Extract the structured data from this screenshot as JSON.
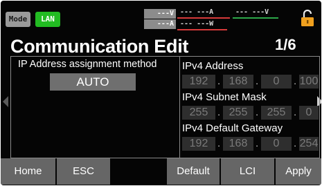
{
  "status_bar": {
    "mode_label": "Mode",
    "connection_label": "LAN",
    "meter": {
      "row1_gray": "---V",
      "row2_gray": "---A",
      "row1_current": "--- ---A",
      "row1_voltage": "--- ---V",
      "row2_power": "--- ---W"
    },
    "lock_icon": "lock-icon"
  },
  "title": "Communication Edit",
  "page_indicator": "1/6",
  "ip_assignment": {
    "label": "IP Address assignment method",
    "value": "AUTO"
  },
  "ipv4_address": {
    "label": "IPv4 Address",
    "octets": [
      "192",
      "168",
      "0",
      "100"
    ]
  },
  "ipv4_subnet_mask": {
    "label": "IPv4 Subnet Mask",
    "octets": [
      "255",
      "255",
      "255",
      "0"
    ]
  },
  "ipv4_default_gateway": {
    "label": "IPv4 Default Gateway",
    "octets": [
      "192",
      "168",
      "0",
      "254"
    ]
  },
  "buttons": {
    "home": "Home",
    "esc": "ESC",
    "default": "Default",
    "lci": "LCI",
    "apply": "Apply"
  },
  "colors": {
    "background": "#050505",
    "lan_green": "#22bb22",
    "lock_orange": "#f0a01e",
    "button_gray": "#666666",
    "meter_red": "#d83a3a",
    "meter_green": "#2da84a"
  }
}
